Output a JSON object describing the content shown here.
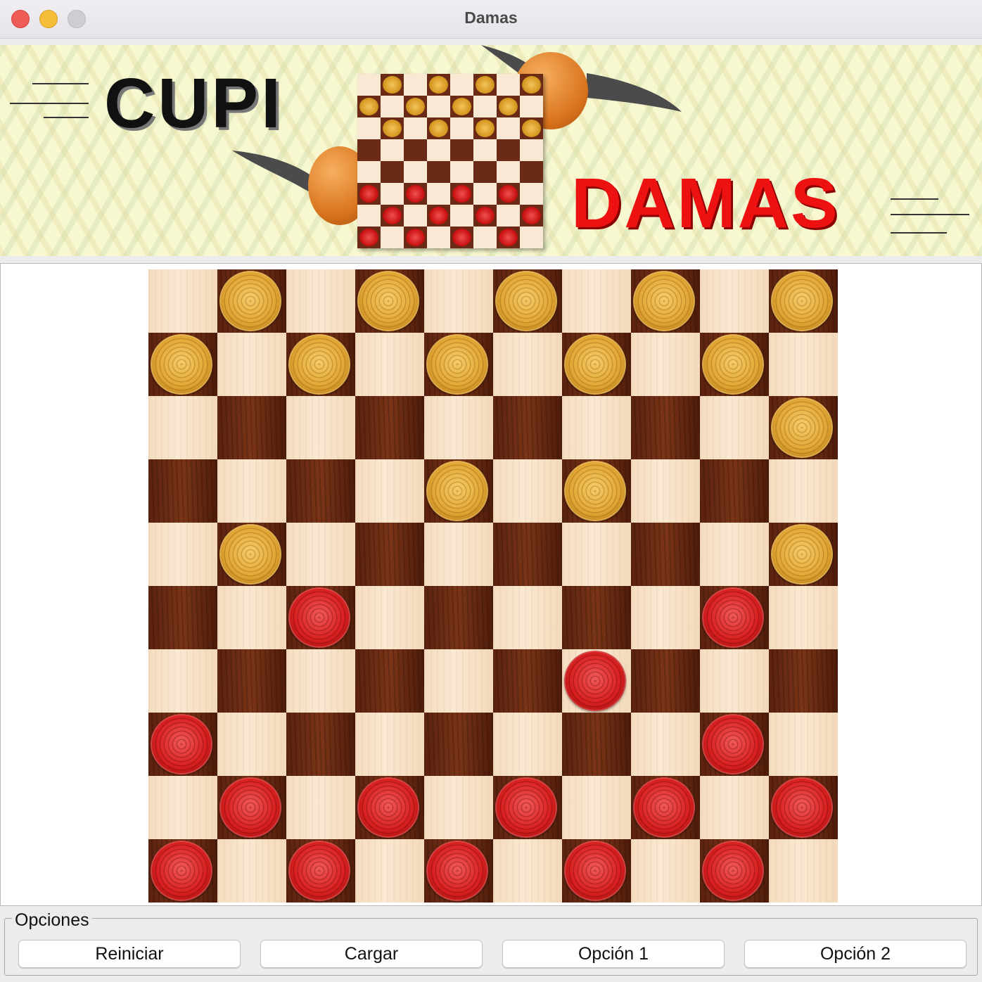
{
  "window": {
    "title": "Damas"
  },
  "banner": {
    "logo_left": "CUPI",
    "logo_right": "DAMAS",
    "mini_board": [
      ".g.g.g.g",
      "g.g.g.g.",
      ".g.g.g.g",
      "........",
      "........",
      "r.r.r.r.",
      ".r.r.r.r",
      "r.r.r.r."
    ]
  },
  "board": {
    "size": 10,
    "rows": [
      ".g.g.g.g.g",
      "g.g.g.g.g.",
      ".........g",
      "....g.g...",
      ".g.......g",
      "..r.....r.",
      "......r...",
      "r.......r.",
      ".r.r.r.r.r",
      "r.r.r.r.r."
    ],
    "colors": {
      "light": "#f7e2c8",
      "dark": "#6b2a13",
      "gold_piece": "#e2a634",
      "red_piece": "#d92020"
    }
  },
  "options": {
    "legend": "Opciones",
    "buttons": [
      "Reiniciar",
      "Cargar",
      "Opción 1",
      "Opción 2"
    ]
  }
}
